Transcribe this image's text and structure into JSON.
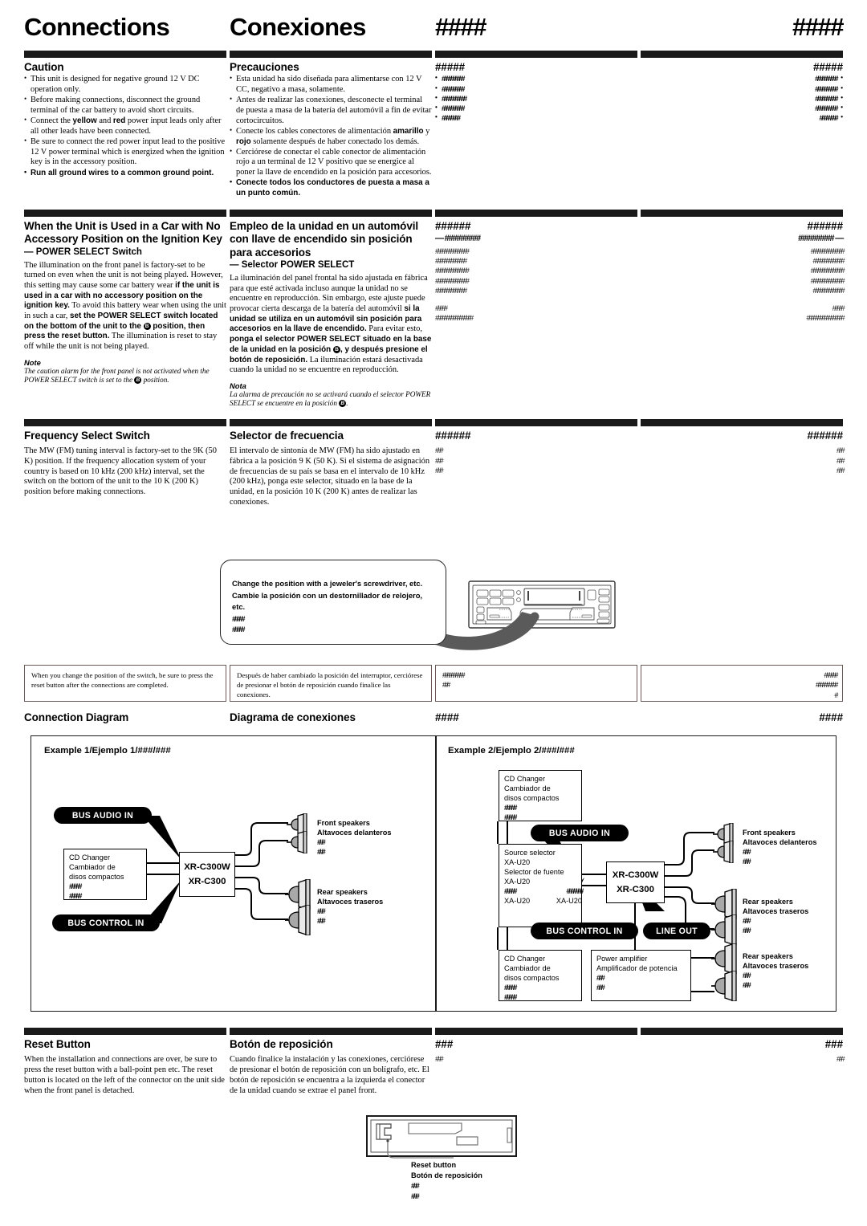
{
  "page": {
    "titles": [
      "Connections",
      "Conexiones",
      "####",
      "####"
    ]
  },
  "sections": {
    "caution": {
      "headings": [
        "Caution",
        "Precauciones",
        "#####",
        "#####"
      ],
      "en_bullets": [
        {
          "text": "This unit is designed for negative ground 12 V DC operation only.",
          "bold": false
        },
        {
          "text": "Before making connections, disconnect the ground terminal of the car battery to avoid short circuits.",
          "bold": false
        },
        {
          "text": "Connect the yellow and red power input leads only after all other leads have been connected.",
          "bold": false
        },
        {
          "text": "Be sure to connect the red power input lead to the positive 12 V power terminal which is energized when the ignition key is in the accessory position.",
          "bold": false
        },
        {
          "text": "Run all ground wires to a common ground point.",
          "bold": true
        }
      ],
      "es_bullets": [
        {
          "text": "Esta unidad ha sido diseñada para alimentarse con 12 V CC, negativo a masa, solamente.",
          "bold": false
        },
        {
          "text": "Antes de realizar las conexiones, desconecte el terminal de puesta a masa de la batería del automóvil a fin de evitar cortocircuitos.",
          "bold": false
        },
        {
          "text": "Conecte los cables conectores de alimentación amarillo y rojo solamente después de haber conectado los demás.",
          "bold": false
        },
        {
          "text": "Cerciórese de conectar el cable conector de alimentación rojo a un terminal de 12 V positivo que se energice al poner la llave de encendido en la posición para accesorios.",
          "bold": false
        },
        {
          "text": "Conecte todos los conductores de puesta a masa a un punto común.",
          "bold": true
        }
      ],
      "hash_bullets_c3": [
        "##########",
        "##########",
        "###########",
        "##########",
        "########"
      ],
      "hash_bullets_c4": [
        "##########",
        "##########",
        "##########",
        "##########",
        "########"
      ]
    },
    "power_select": {
      "headings": [
        "When the Unit is Used in a Car with No Accessory Position on the Ignition Key",
        "Empleo de la unidad en un automóvil con llave de encendido sin posición para accesorios",
        "######",
        "######"
      ],
      "subheadings": [
        "— POWER SELECT Switch",
        "— Selector POWER SELECT",
        "— #########",
        "######### —"
      ],
      "en_body_1": "The illumination on the front panel is factory-set to be turned on even when the unit is not being played. However, this setting may cause some car battery wear ",
      "en_body_b1": "if the unit is used in a car with no accessory position on the ignition key.",
      "en_body_2": " To avoid this battery wear when using the unit in such a car, ",
      "en_body_b2": "set the POWER SELECT switch located on the bottom of the unit to the",
      "en_body_b3": "position, then press the reset button.",
      "en_body_3": " The illumination is reset to stay off while the unit is not being played.",
      "en_note_heading": "Note",
      "en_note_1": "The caution alarm for the front panel is not activated when the POWER SELECT switch is set to the",
      "en_note_2": "position.",
      "es_body_1": "La iluminación del panel frontal ha sido ajustada en fábrica para que esté activada incluso aunque la unidad no se encuentre en reproducción. Sin embargo, este ajuste puede provocar cierta descarga de la batería del automóvil ",
      "es_body_b1": "si la unidad se utiliza en un automóvil sin posición para accesorios en la llave de encendido.",
      "es_body_2": " Para evitar esto, ",
      "es_body_b2": "ponga el selector POWER SELECT situado en la base de la unidad en la posición",
      "es_body_b3": ", y después presione el botón de reposición.",
      "es_body_3": " La iluminación estará desactivada cuando la unidad no se encuentre en reproducción.",
      "es_note_heading": "Nota",
      "es_note_1": "La alarma de precaución no se activará cuando el selector POWER SELECT se encuentre en la posición",
      "es_note_2": ".",
      "circle_label": "B",
      "hash_lines_c3": [
        "###############",
        "##############",
        "###############",
        "###############",
        "##############"
      ],
      "hash_lines_c4": [
        "###############",
        "##############",
        "###############",
        "###############",
        "##############"
      ],
      "hash_note_c3": [
        "#####",
        "#################"
      ],
      "hash_note_c4": [
        "#####",
        "#################"
      ]
    },
    "frequency": {
      "headings": [
        "Frequency Select Switch",
        "Selector de frecuencia",
        "######",
        "######"
      ],
      "en_body": "The MW (FM) tuning interval is factory-set to the 9K (50 K) position. If the frequency allocation system of your country is based on 10 kHz (200 kHz) interval, set the switch on the bottom of the unit to the 10 K (200 K) position before making connections.",
      "es_body": "El intervalo de sintonía de MW (FM) ha sido ajustado en fábrica a la posición 9 K (50 K). Si el sistema de asignación de frecuencias de su país se basa en el intervalo de 10 kHz (200 kHz), ponga este selector, situado en la base de la unidad, en la posición 10 K (200 K) antes de realizar las conexiones.",
      "hash_lines_c3": [
        "###",
        "###",
        "###"
      ],
      "hash_lines_c4": [
        "###",
        "###",
        "###"
      ]
    },
    "callout": {
      "line_en": "Change the position with a jeweler's screwdriver, etc.",
      "line_es": "Cambie la posición con un destornillador de relojero, etc.",
      "line_c3": "#####",
      "line_c4": "#####"
    },
    "switch_notes": {
      "en": "When you change the position of the switch, be sure to press the reset button after the connections are completed.",
      "es": "Después de haber cambiado la posición del interruptor, cerciórese de presionar el botón de reposición cuando finalice las conexiones.",
      "c3": [
        "##########",
        "###"
      ],
      "c4": [
        "######",
        "##########",
        "#"
      ]
    },
    "connection_diagram": {
      "headings": [
        "Connection Diagram",
        "Diagrama de conexiones",
        "####",
        "####"
      ],
      "example1": {
        "title": "Example 1/Ejemplo 1/###/###",
        "cd_changer": [
          "CD Changer",
          "Cambiador de",
          "disos compactos",
          "#####",
          "#####"
        ],
        "unit": [
          "XR-C300W",
          "XR-C300"
        ],
        "pill_audio": "BUS AUDIO IN",
        "pill_control": "BUS CONTROL IN",
        "front_speakers": [
          "Front speakers",
          "Altavoces delanteros",
          "###",
          "###"
        ],
        "rear_speakers": [
          "Rear speakers",
          "Altavoces traseros",
          "###",
          "###"
        ]
      },
      "example2": {
        "title": "Example 2/Ejemplo 2/###/###",
        "cd_changer_top": [
          "CD Changer",
          "Cambiador de",
          "disos compactos",
          "#####",
          "#####"
        ],
        "source_selector": [
          "Source selector",
          "XA-U20",
          "Selector de fuente",
          "XA-U20",
          "#####",
          "XA-U20"
        ],
        "source_selector_right": [
          "#######",
          "XA-U20"
        ],
        "cd_changer_bottom": [
          "CD Changer",
          "Cambiador de",
          "disos compactos",
          "#####",
          "#####"
        ],
        "power_amp": [
          "Power amplifier",
          "Amplificador de potencia",
          "###",
          "###"
        ],
        "unit": [
          "XR-C300W",
          "XR-C300"
        ],
        "pill_audio": "BUS AUDIO IN",
        "pill_control": "BUS CONTROL IN",
        "pill_lineout": "LINE OUT",
        "front_speakers": [
          "Front speakers",
          "Altavoces delanteros",
          "###",
          "###"
        ],
        "rear_speakers_1": [
          "Rear speakers",
          "Altavoces traseros",
          "###",
          "###"
        ],
        "rear_speakers_2": [
          "Rear speakers",
          "Altavoces traseros",
          "###",
          "###"
        ]
      }
    },
    "reset": {
      "headings": [
        "Reset Button",
        "Botón de reposición",
        "###",
        "###"
      ],
      "en_body": "When the installation and connections are over, be sure to press the reset button with a ball-point pen etc. The reset button is located on the left of the connector on the unit side when the front panel is detached.",
      "es_body": "Cuando finalice la instalación y las conexiones, cerciórese de presionar el botón de reposición con un bolígrafo, etc. El botón de reposición se encuentra a la izquierda el conector de la unidad cuando se extrae el panel front.",
      "hash_c3": "###",
      "hash_c4": "###",
      "illustration_label": [
        "Reset button",
        "Botón de reposición",
        "###",
        "###"
      ]
    }
  },
  "colors": {
    "rule": "#1a1a1a",
    "note_border": "#6b5a55",
    "pill_bg": "#000000",
    "text": "#000000"
  }
}
